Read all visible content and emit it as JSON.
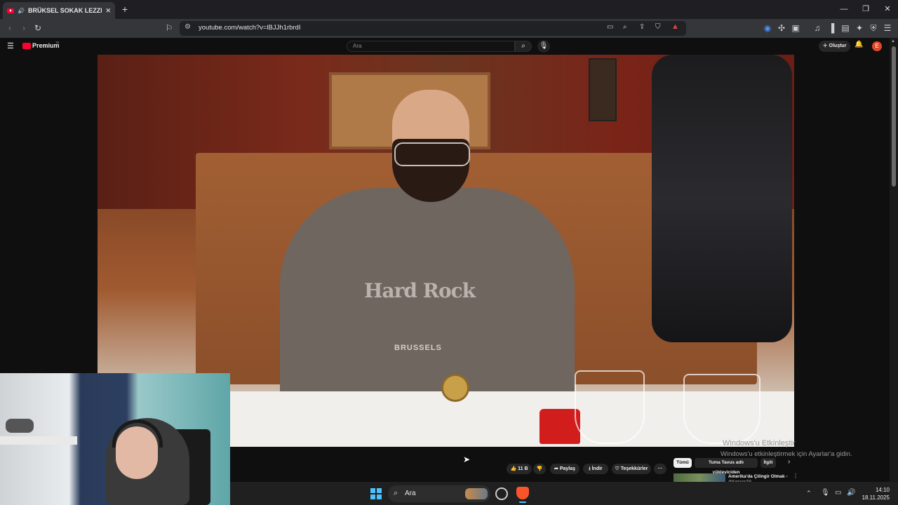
{
  "browser": {
    "tab_title": "BRÜKSEL SOKAK LEZZETLERİ",
    "tab_close": "✕",
    "new_tab": "+",
    "url": "youtube.com/watch?v=lBJJh1rbrdI",
    "window_controls": {
      "minimize": "—",
      "maximize": "❐",
      "close": "✕"
    }
  },
  "youtube": {
    "logo_text": "Premium",
    "logo_badge": "TR",
    "search_placeholder": "Ara",
    "create_label": "Oluştur",
    "avatar_letter": "E",
    "actions": {
      "like_count": "11 B",
      "share": "Paylaş",
      "download": "İndir",
      "thanks": "Teşekkürler",
      "more": "···"
    },
    "chips": [
      "Tümü",
      "Tuma Tavus adlı yükleyiciden",
      "İlgili"
    ],
    "recommendation": {
      "title": "Amerika'da Çilingir Olmak -",
      "channel": "@KamyonTR"
    }
  },
  "video": {
    "shirt_brand": "Hard Rock",
    "shirt_city": "BRUSSELS"
  },
  "windows_activation": {
    "line1": "Windows'u Etkinleştir",
    "line2": "Windows'u etkinleştirmek için Ayarlar'a gidin."
  },
  "taskbar": {
    "search_label": "Ara",
    "time": "14:10",
    "date": "18.11.2025"
  }
}
